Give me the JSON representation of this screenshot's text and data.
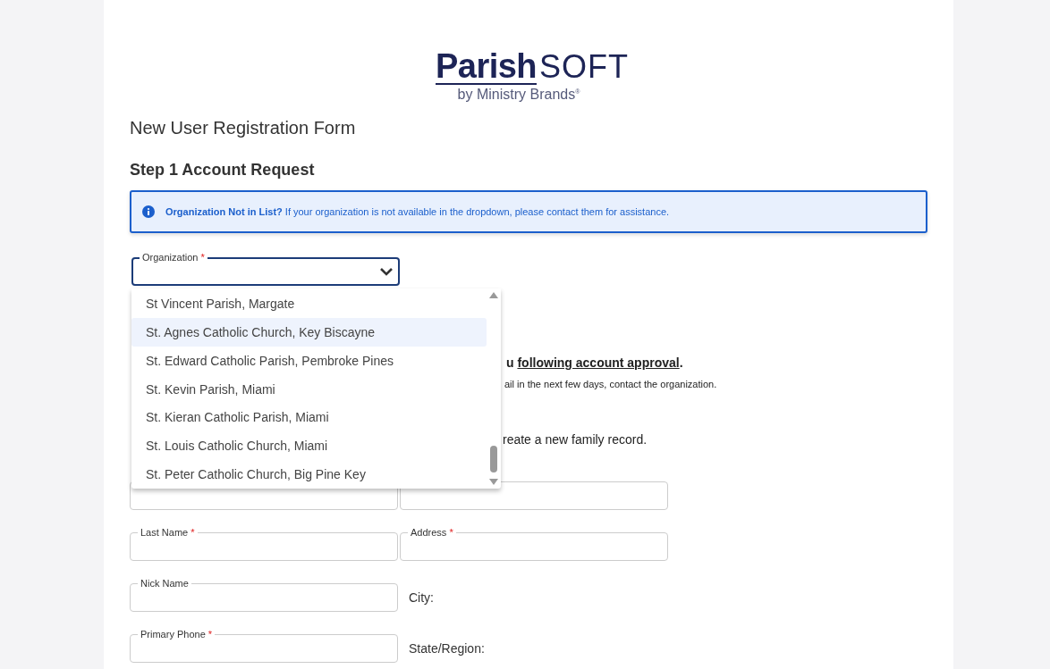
{
  "logo": {
    "name_bold": "Parish",
    "name_light": "SOFT",
    "tagline": "by Ministry Brands$^{®}$"
  },
  "form_title": "New User Registration Form",
  "step_heading": "**Step 1** Account Request",
  "info_banner": "**Organization Not in List?** If your organization is not available in the dropdown, please contact them for assistance.",
  "organization_field": {
    "label": "Organization",
    "asterisk": "*",
    "expanded": true
  },
  "dropdown_options": [
    {
      "label": "St Vincent Parish, Margate",
      "selected": false
    },
    {
      "label": "St. Agnes Catholic Church, Key Biscayne",
      "selected": true
    },
    {
      "label": "St. Edward Catholic Parish, Pembroke Pines",
      "selected": false
    },
    {
      "label": "St. Kevin Parish, Miami",
      "selected": false
    },
    {
      "label": "St. Kieran Catholic Parish, Miami",
      "selected": false
    },
    {
      "label": "St. Louis Catholic Church, Miami",
      "selected": false
    },
    {
      "label": "St. Peter Catholic Church, Big Pine Key",
      "selected": false
    }
  ],
  "partial_texts": [
    "u **following account approval**.",
    "ail in the next few days, contact the organization.",
    "reate a new family record."
  ],
  "field_rows": [
    {
      "left": {
        "kind": "field"
      },
      "right": {
        "kind": "field"
      }
    },
    {
      "left": {
        "kind": "field",
        "label": "Last Name",
        "asterisk": "*"
      },
      "right": {
        "kind": "field",
        "label": "Address",
        "asterisk": "*"
      }
    },
    {
      "left": {
        "kind": "field",
        "label": "Nick Name"
      },
      "right": {
        "kind": "static",
        "label": "City:"
      }
    },
    {
      "left": {
        "kind": "field",
        "label": "Primary Phone",
        "asterisk": "*"
      },
      "right": {
        "kind": "static",
        "label": "State/Region:"
      }
    }
  ]
}
